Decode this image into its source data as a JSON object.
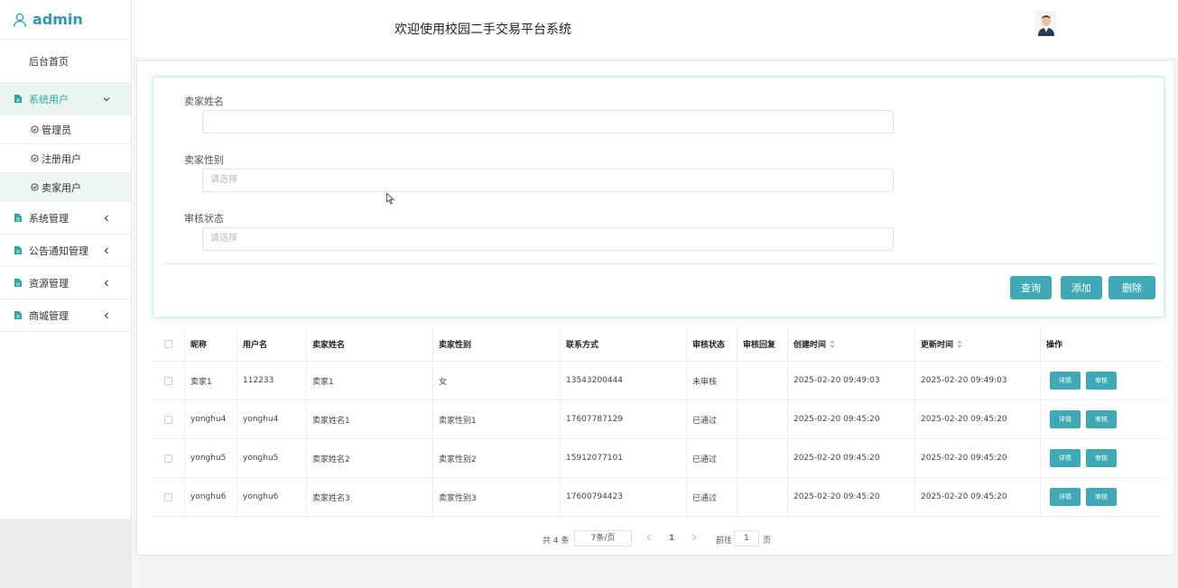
{
  "sidebar": {
    "brand": "admin",
    "home": "后台首页",
    "group_users": "系统用户",
    "sub_items": [
      "管理员",
      "注册用户",
      "卖家用户"
    ],
    "groups": [
      "系统管理",
      "公告通知管理",
      "资源管理",
      "商城管理"
    ]
  },
  "header": {
    "title": "欢迎使用校园二手交易平台系统"
  },
  "search": {
    "seller_name_label": "卖家姓名",
    "seller_name_value": "",
    "seller_gender_label": "卖家性别",
    "seller_gender_placeholder": "请选择",
    "audit_status_label": "审核状态",
    "audit_status_placeholder": "请选择",
    "query_btn": "查询",
    "add_btn": "添加",
    "delete_btn": "删除"
  },
  "table": {
    "headers": [
      "昵称",
      "用户名",
      "卖家姓名",
      "卖家性别",
      "联系方式",
      "审核状态",
      "审核回复",
      "创建时间",
      "更新时间",
      "操作"
    ],
    "detail_btn": "详情",
    "audit_btn": "审核",
    "rows": [
      {
        "nick": "卖家1",
        "user": "112233",
        "name": "卖家1",
        "gender": "女",
        "phone": "13543200444",
        "status": "未审核",
        "reply": "",
        "created": "2025-02-20 09:49:03",
        "updated": "2025-02-20 09:49:03"
      },
      {
        "nick": "yonghu4",
        "user": "yonghu4",
        "name": "卖家姓名1",
        "gender": "卖家性别1",
        "phone": "17607787129",
        "status": "已通过",
        "reply": "",
        "created": "2025-02-20 09:45:20",
        "updated": "2025-02-20 09:45:20"
      },
      {
        "nick": "yonghu5",
        "user": "yonghu5",
        "name": "卖家姓名2",
        "gender": "卖家性别2",
        "phone": "15912077101",
        "status": "已通过",
        "reply": "",
        "created": "2025-02-20 09:45:20",
        "updated": "2025-02-20 09:45:20"
      },
      {
        "nick": "yonghu6",
        "user": "yonghu6",
        "name": "卖家姓名3",
        "gender": "卖家性别3",
        "phone": "17600794423",
        "status": "已通过",
        "reply": "",
        "created": "2025-02-20 09:45:20",
        "updated": "2025-02-20 09:45:20"
      }
    ]
  },
  "pager": {
    "total": "共 4 条",
    "page_size": "7条/页",
    "current": "1",
    "goto_label": "前往",
    "goto_value": "1",
    "unit": "页"
  },
  "colors": {
    "accent": "#3fa9b5",
    "brand": "#2a9bb0",
    "menu_active_bg": "#eaf5f3"
  }
}
